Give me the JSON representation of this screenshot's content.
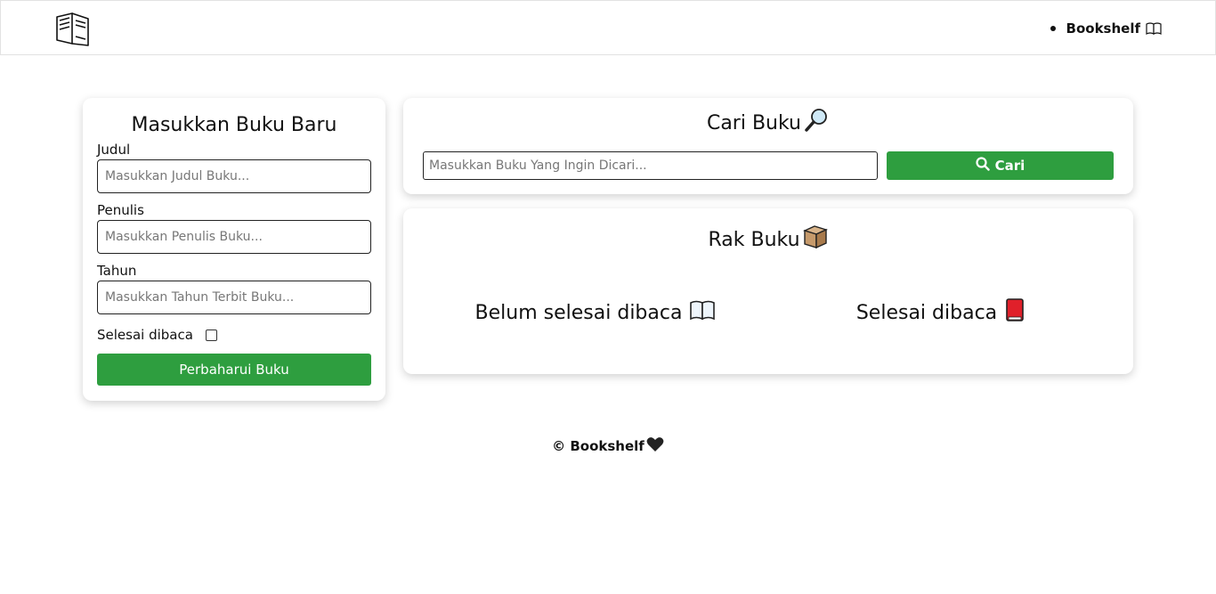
{
  "navbar": {
    "logo_icon": "open-book-outline-icon",
    "links": [
      {
        "label": "Bookshelf",
        "emoji": "open-book-icon"
      }
    ]
  },
  "form": {
    "title": "Masukkan Buku Baru",
    "fields": {
      "title": {
        "label": "Judul",
        "placeholder": "Masukkan Judul Buku..."
      },
      "author": {
        "label": "Penulis",
        "placeholder": "Masukkan Penulis Buku..."
      },
      "year": {
        "label": "Tahun",
        "placeholder": "Masukkan Tahun Terbit Buku..."
      }
    },
    "done_label": "Selesai dibaca",
    "done_checked": false,
    "submit_label": "Perbaharui Buku"
  },
  "search": {
    "title": "Cari Buku",
    "title_icon": "magnifying-glass-icon",
    "placeholder": "Masukkan Buku Yang Ingin Dicari...",
    "button_label": "Cari",
    "button_icon": "search-icon"
  },
  "shelf": {
    "title": "Rak Buku",
    "title_icon": "package-icon",
    "unfinished": {
      "label": "Belum selesai dibaca",
      "icon": "open-book-icon"
    },
    "finished": {
      "label": "Selesai dibaca",
      "icon": "red-book-icon"
    }
  },
  "footer": {
    "text": "© Bookshelf",
    "icon": "black-heart-icon"
  },
  "colors": {
    "accent": "#2e9e3f",
    "border": "#222222"
  }
}
